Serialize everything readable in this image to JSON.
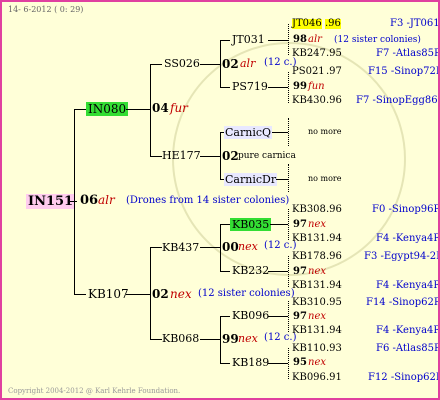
{
  "header": {
    "date": "14- 6-2012",
    "time": "( 0: 29)"
  },
  "footer": {
    "copyright": "Copyright 2004-2012 @ Karl Kehrle Foundation."
  },
  "colors": {
    "border": "#e040a0",
    "background": "#ffffd8",
    "highlight_green": "#33dd33",
    "highlight_yellow": "#ffff00",
    "highlight_pink": "#ffccee",
    "highlight_lavender": "#e8e8ff"
  },
  "root": {
    "name": "IN151",
    "year": "06",
    "breed": "alr",
    "note": "(Drones from 14 sister colonies)"
  },
  "gen1": {
    "upper": {
      "name": "IN080"
    },
    "upper_note": {
      "year": "04",
      "breed": "fur"
    },
    "lower": {
      "name": "KB107"
    },
    "lower_note": {
      "year": "02",
      "breed": "nex",
      "note": "(12 sister colonies)"
    }
  },
  "gen2": {
    "ss026": {
      "name": "SS026",
      "year": "02",
      "breed": "alr",
      "note": "(12 c.)"
    },
    "he177": {
      "name": "HE177",
      "year": "02",
      "breed": "pure carnica"
    },
    "kb437": {
      "name": "KB437",
      "year": "00",
      "breed": "nex",
      "note": "(12 c.)"
    },
    "kb068": {
      "name": "KB068",
      "year": "99",
      "breed": "nex",
      "note": "(12 c.)"
    }
  },
  "gen3": {
    "jt031": "JT031",
    "ps719": "PS719",
    "carnicq": "CarnicQ",
    "carnicdr": "CarnicDr",
    "kb035": "KB035",
    "kb232": "KB232",
    "kb096": "KB096",
    "kb189": "KB189"
  },
  "gen4": [
    {
      "id": "JT046",
      "year": ".96",
      "ref": "F3 -JT061"
    },
    {
      "year": "98",
      "breed": "alr",
      "note": "(12 sister colonies)"
    },
    {
      "id": "KB247",
      "year": ".95",
      "ref": "F7 -Atlas85R"
    },
    {
      "id": "PS021",
      "year": ".97",
      "ref": "F15 -Sinop72R"
    },
    {
      "year": "99",
      "breed": "fun"
    },
    {
      "id": "KB430",
      "year": ".96",
      "ref": "F7 -SinopEgg86R"
    },
    {
      "label": "no more"
    },
    {
      "label": "no more"
    },
    {
      "id": "KB308",
      "year": ".96",
      "ref": "F0 -Sinop96R"
    },
    {
      "year": "97",
      "breed": "nex"
    },
    {
      "id": "KB131",
      "year": ".94",
      "ref": "F4 -Kenya4R"
    },
    {
      "id": "KB178",
      "year": ".96",
      "ref": "F3 -Egypt94-2R"
    },
    {
      "year": "97",
      "breed": "nex"
    },
    {
      "id": "KB131",
      "year": ".94",
      "ref": "F4 -Kenya4R"
    },
    {
      "id": "KB310",
      "year": ".95",
      "ref": "F14 -Sinop62R"
    },
    {
      "year": "97",
      "breed": "nex"
    },
    {
      "id": "KB131",
      "year": ".94",
      "ref": "F4 -Kenya4R"
    },
    {
      "id": "KB110",
      "year": ".93",
      "ref": "F6 -Atlas85R"
    },
    {
      "year": "95",
      "breed": "nex"
    },
    {
      "id": "KB096",
      "year": ".91",
      "ref": "F12 -Sinop62R"
    }
  ]
}
